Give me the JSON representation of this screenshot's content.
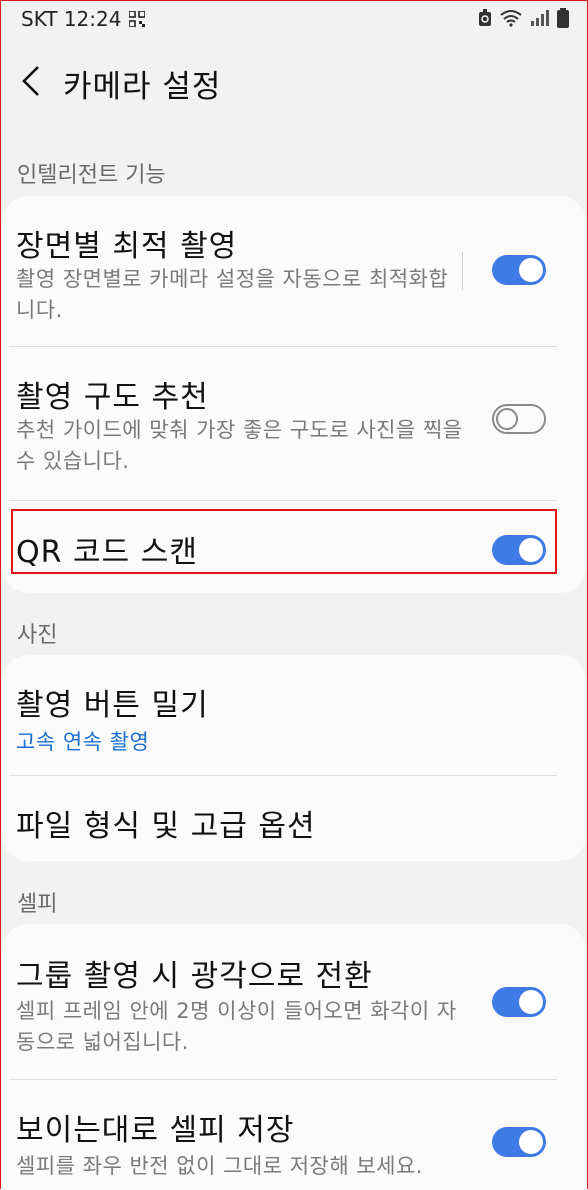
{
  "status_bar": {
    "carrier_time": "SKT 12:24",
    "icons": [
      "qr-icon",
      "recycle-icon",
      "wifi-icon",
      "signal-icon",
      "battery-icon"
    ]
  },
  "header": {
    "title": "카메라 설정"
  },
  "sections": {
    "intelligent": {
      "label": "인텔리전트 기능"
    },
    "photo": {
      "label": "사진"
    },
    "selfie": {
      "label": "셀피"
    }
  },
  "settings": {
    "scene_optimizer": {
      "title": "장면별 최적 촬영",
      "desc": "촬영 장면별로 카메라 설정을 자동으로 최적화합니다.",
      "enabled": true
    },
    "shot_suggestions": {
      "title": "촬영 구도 추천",
      "desc": "추천 가이드에 맞춰 가장 좋은 구도로 사진을 찍을 수 있습니다.",
      "enabled": false
    },
    "qr_scan": {
      "title": "QR 코드 스캔",
      "enabled": true
    },
    "swipe_shutter": {
      "title": "촬영 버튼 밀기",
      "value": "고속 연속 촬영"
    },
    "formats": {
      "title": "파일 형식 및 고급 옵션"
    },
    "group_wide": {
      "title": "그룹 촬영 시 광각으로 전환",
      "desc": "셀피 프레임 안에 2명 이상이 들어오면 화각이 자동으로 넓어집니다.",
      "enabled": true
    },
    "save_as_preview": {
      "title": "보이는대로 셀피 저장",
      "desc": "셀피를 좌우 반전 없이 그대로 저장해 보세요.",
      "enabled": true
    }
  },
  "colors": {
    "accent": "#3e7be6",
    "link": "#1a6fd1",
    "highlight": "#e0141a"
  }
}
